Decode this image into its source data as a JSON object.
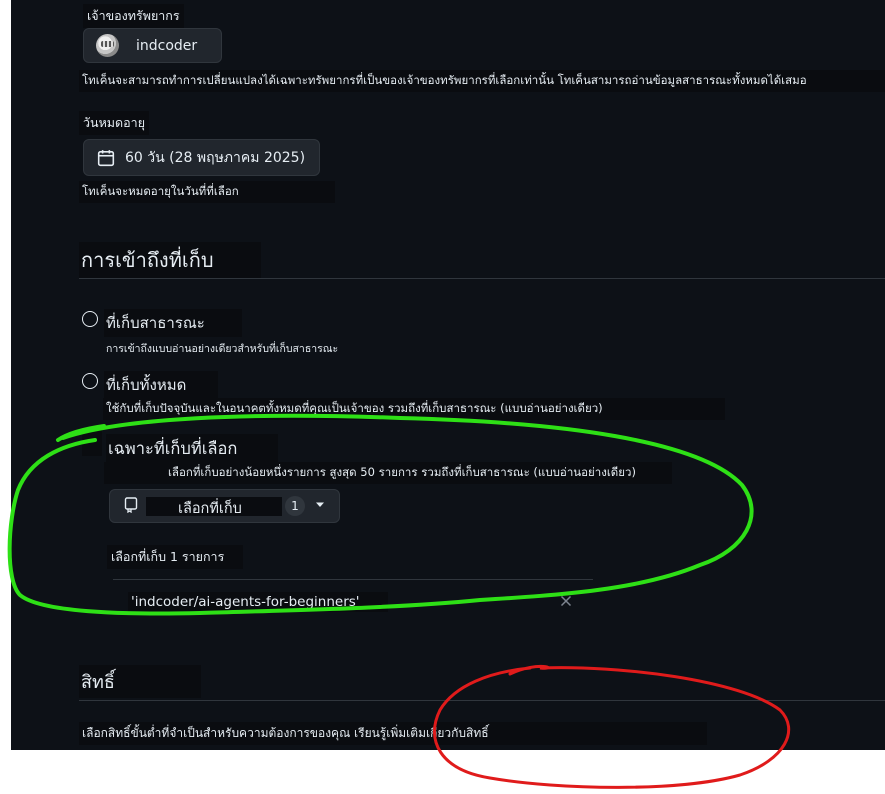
{
  "owner": {
    "label": "เจ้าของทรัพยากร",
    "username": "indcoder",
    "help": "โทเค็นจะสามารถทำการเปลี่ยนแปลงได้เฉพาะทรัพยากรที่เป็นของเจ้าของทรัพยากรที่เลือกเท่านั้น โทเค็นสามารถอ่านข้อมูลสาธารณะทั้งหมดได้เสมอ"
  },
  "expiration": {
    "label": "วันหมดอายุ",
    "value": "60 วัน (28 พฤษภาคม 2025)",
    "help": "โทเค็นจะหมดอายุในวันที่ที่เลือก"
  },
  "repo_access": {
    "title": "การเข้าถึงที่เก็บ",
    "options": [
      {
        "label": "ที่เก็บสาธารณะ",
        "description": "การเข้าถึงแบบอ่านอย่างเดียวสำหรับที่เก็บสาธารณะ",
        "selected": false
      },
      {
        "label": "ที่เก็บทั้งหมด",
        "description": "ใช้กับที่เก็บปัจจุบันและในอนาคตทั้งหมดที่คุณเป็นเจ้าของ รวมถึงที่เก็บสาธารณะ (แบบอ่านอย่างเดียว)",
        "selected": false
      },
      {
        "label": "เฉพาะที่เก็บที่เลือก",
        "description": "เลือกที่เก็บอย่างน้อยหนึ่งรายการ สูงสุด 50 รายการ รวมถึงที่เก็บสาธารณะ (แบบอ่านอย่างเดียว)",
        "selected": true
      }
    ],
    "select_button": "เลือกที่เก็บ",
    "select_count": "1",
    "selected_summary": "เลือกที่เก็บ 1 รายการ",
    "selected_repos": [
      "'indcoder/ai-agents-for-beginners'"
    ]
  },
  "permissions": {
    "title": "สิทธิ์",
    "help": "เลือกสิทธิ์ขั้นต่ำที่จำเป็นสำหรับความต้องการของคุณ เรียนรู้เพิ่มเติมเกี่ยวกับสิทธิ์"
  },
  "colors": {
    "background": "#0d1117",
    "green_annotation": "#2ee016",
    "red_annotation": "#e01b1b"
  }
}
